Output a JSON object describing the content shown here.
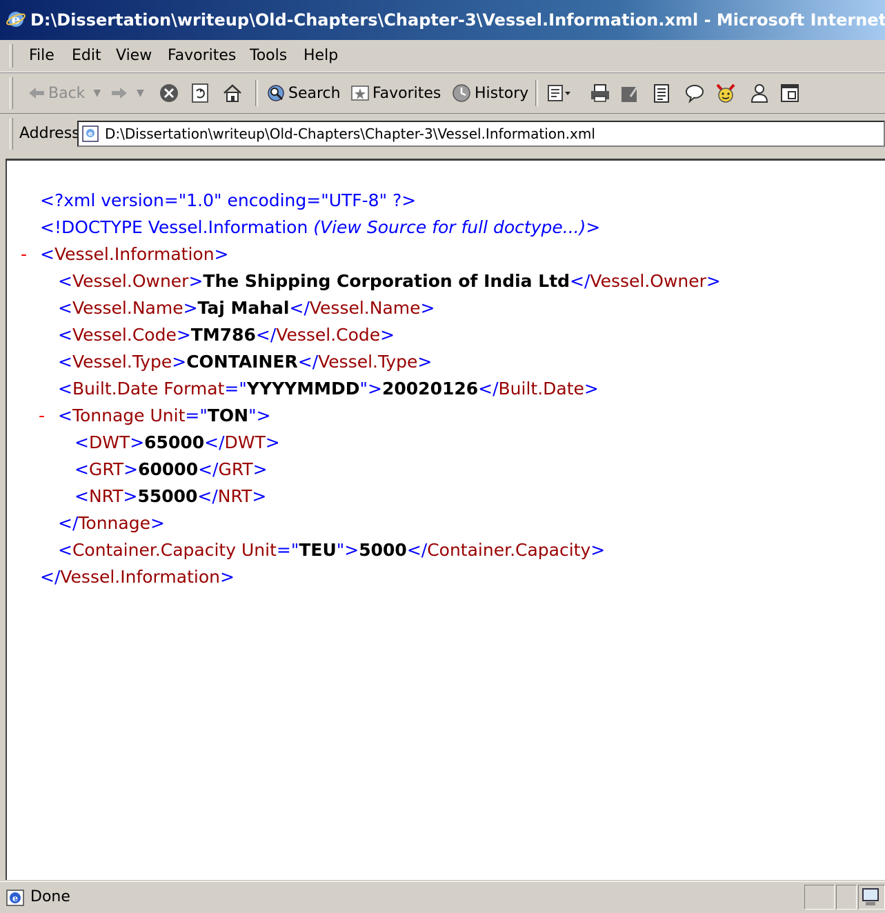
{
  "window": {
    "title": "D:\\Dissertation\\writeup\\Old-Chapters\\Chapter-3\\Vessel.Information.xml - Microsoft Internet Explorer",
    "icon": "ie-icon"
  },
  "menu": [
    "File",
    "Edit",
    "View",
    "Favorites",
    "Tools",
    "Help"
  ],
  "toolbar": {
    "back_label": "Back",
    "search_label": "Search",
    "favorites_label": "Favorites",
    "history_label": "History"
  },
  "address": {
    "label": "Address",
    "url": "D:\\Dissertation\\writeup\\Old-Chapters\\Chapter-3\\Vessel.Information.xml"
  },
  "xml": {
    "declaration": "<?xml version=\"1.0\" encoding=\"UTF-8\" ?>",
    "doctype_prefix": "<!DOCTYPE Vessel.Information ",
    "doctype_note": "(View Source for full doctype...)",
    "doctype_suffix": ">",
    "root_tag": "Vessel.Information",
    "owner_tag": "Vessel.Owner",
    "owner_value": "The Shipping Corporation of India Ltd",
    "name_tag": "Vessel.Name",
    "name_value": "Taj Mahal",
    "code_tag": "Vessel.Code",
    "code_value": "TM786",
    "type_tag": "Vessel.Type",
    "type_value": "CONTAINER",
    "built_tag": "Built.Date",
    "built_attr": "Format",
    "built_attr_value": "YYYYMMDD",
    "built_value": "20020126",
    "tonnage_tag": "Tonnage",
    "tonnage_attr": "Unit",
    "tonnage_attr_value": "TON",
    "dwt_tag": "DWT",
    "dwt_value": "65000",
    "grt_tag": "GRT",
    "grt_value": "60000",
    "nrt_tag": "NRT",
    "nrt_value": "55000",
    "capacity_tag": "Container.Capacity",
    "capacity_attr": "Unit",
    "capacity_attr_value": "TEU",
    "capacity_value": "5000",
    "collapse_symbol": "-"
  },
  "status": {
    "text": "Done"
  },
  "colors": {
    "tag": "#990000",
    "bracket": "#0000ff",
    "value": "#000000",
    "collapse": "#ff0000"
  }
}
